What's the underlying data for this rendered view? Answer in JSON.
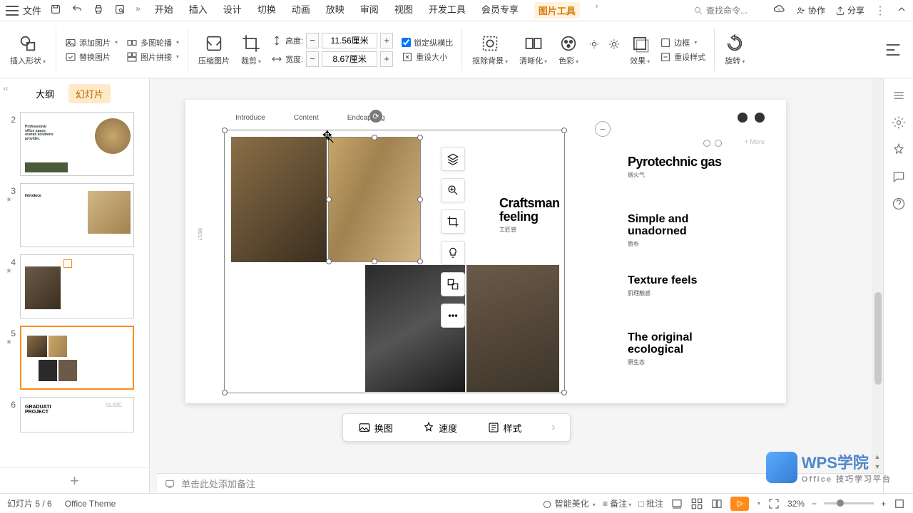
{
  "menubar": {
    "file": "文件",
    "tabs": [
      "开始",
      "插入",
      "设计",
      "切换",
      "动画",
      "放映",
      "审阅",
      "视图",
      "开发工具",
      "会员专享",
      "图片工具"
    ],
    "active_tab_index": 10,
    "search_placeholder": "查找命令...",
    "collab": "协作",
    "share": "分享"
  },
  "ribbon": {
    "insert_shape": "插入形状",
    "add_image": "添加图片",
    "replace_image": "替换图片",
    "multi_carousel": "多图轮播",
    "image_collage": "图片拼接",
    "compress_image": "压缩图片",
    "crop": "裁剪",
    "height_label": "高度:",
    "height_value": "11.56厘米",
    "width_label": "宽度:",
    "width_value": "8.67厘米",
    "lock_ratio": "锁定纵横比",
    "reset_size": "重设大小",
    "remove_bg": "抠除背景",
    "clarity": "清晰化",
    "color": "色彩",
    "effects": "效果",
    "border": "边框",
    "reset_style": "重设样式",
    "rotate": "旋转"
  },
  "slidepanel": {
    "tab_outline": "大纲",
    "tab_slides": "幻灯片",
    "slides": [
      {
        "num": "2"
      },
      {
        "num": "3"
      },
      {
        "num": "4"
      },
      {
        "num": "5"
      },
      {
        "num": "6"
      }
    ],
    "thumb2_line1": "Professional",
    "thumb2_line2": "office space",
    "thumb2_line3": "overall solutions",
    "thumb2_line4": "provider.",
    "thumb3_title": "Introduce",
    "thumb6_line1": "GRADUATI",
    "thumb6_line2": "PROJECT",
    "thumb6_slide": "SLIDE"
  },
  "slide": {
    "nav": [
      "Introduce",
      "Content",
      "Endcapping"
    ],
    "more": "+ More",
    "side": "05/17",
    "craftsman_h": "Craftsman feeling",
    "craftsman_sub": "工匠感",
    "pyro_h": "Pyrotechnic gas",
    "pyro_sub": "烟火气",
    "simple_h": "Simple and unadorned",
    "simple_sub": "质朴",
    "texture_h": "Texture feels",
    "texture_sub": "肌理触感",
    "original_h": "The original ecological",
    "original_sub": "原生态"
  },
  "float_tools": {
    "layers": "layers",
    "zoom": "zoom",
    "crop": "crop",
    "bulb": "idea",
    "group": "group",
    "more": "more"
  },
  "action_bar": {
    "change_image": "换图",
    "speed": "速度",
    "style": "样式"
  },
  "notes_placeholder": "单击此处添加备注",
  "status": {
    "slide_pos": "幻灯片 5 / 6",
    "theme": "Office Theme",
    "beautify": "智能美化",
    "notes": "备注",
    "approve": "批注",
    "zoom": "32%"
  },
  "watermark": {
    "title": "WPS学院",
    "sub": "Office 技巧学习平台"
  }
}
